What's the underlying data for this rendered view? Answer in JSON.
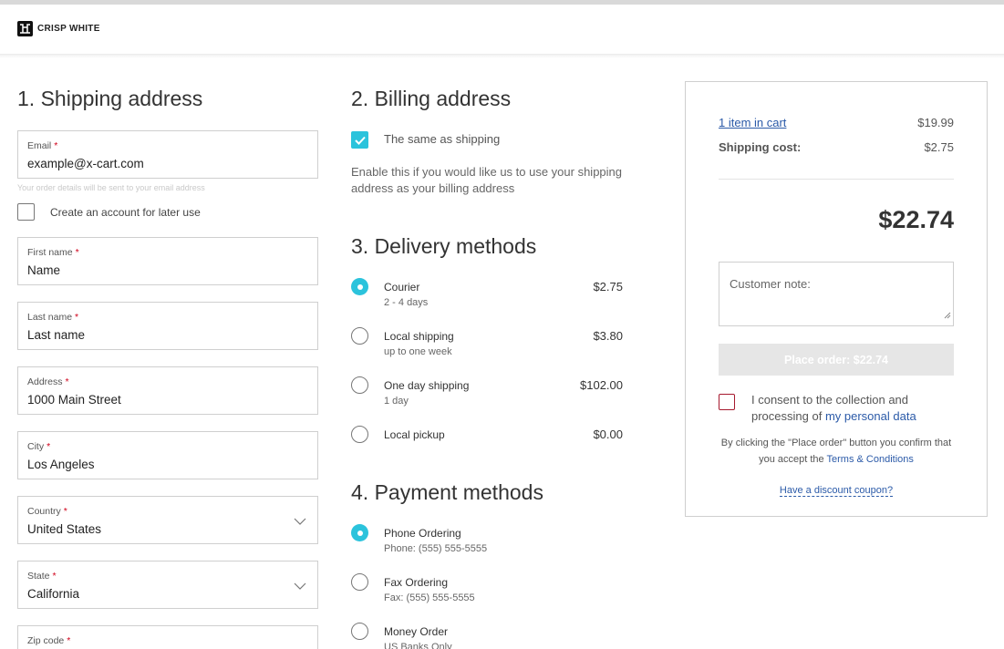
{
  "brand": {
    "name": "CRISP WHITE"
  },
  "shipping": {
    "title": "1. Shipping address",
    "email": {
      "label": "Email",
      "value": "example@x-cart.com",
      "hint": "Your order details will be sent to your email address"
    },
    "create_account_label": "Create an account for later use",
    "first_name": {
      "label": "First name",
      "value": "Name"
    },
    "last_name": {
      "label": "Last name",
      "value": "Last name"
    },
    "address": {
      "label": "Address",
      "value": "1000 Main Street"
    },
    "city": {
      "label": "City",
      "value": "Los Angeles"
    },
    "country": {
      "label": "Country",
      "value": "United States"
    },
    "state": {
      "label": "State",
      "value": "California"
    },
    "zip": {
      "label": "Zip code",
      "value": ""
    },
    "required_mark": "*"
  },
  "billing": {
    "title": "2. Billing address",
    "same_label": "The same as shipping",
    "description": "Enable this if you would like us to use your shipping address as your billing address"
  },
  "delivery": {
    "title": "3. Delivery methods",
    "options": [
      {
        "name": "Courier",
        "sub": "2 - 4 days",
        "price": "$2.75",
        "selected": true
      },
      {
        "name": "Local shipping",
        "sub": "up to one week",
        "price": "$3.80",
        "selected": false
      },
      {
        "name": "One day shipping",
        "sub": "1 day",
        "price": "$102.00",
        "selected": false
      },
      {
        "name": "Local pickup",
        "sub": "",
        "price": "$0.00",
        "selected": false
      }
    ]
  },
  "payment": {
    "title": "4. Payment methods",
    "options": [
      {
        "name": "Phone Ordering",
        "sub": "Phone: (555) 555-5555",
        "selected": true
      },
      {
        "name": "Fax Ordering",
        "sub": "Fax: (555) 555-5555",
        "selected": false
      },
      {
        "name": "Money Order",
        "sub": "US Banks Only",
        "selected": false
      }
    ]
  },
  "summary": {
    "items_link": "1 item in cart",
    "items_price": "$19.99",
    "shipping_label": "Shipping cost:",
    "shipping_price": "$2.75",
    "total": "$22.74",
    "note_placeholder": "Customer note:",
    "place_order_label": "Place order: $22.74",
    "consent_text": "I consent to the collection and processing of",
    "consent_link": "my personal data",
    "terms_text": "By clicking the \"Place order\" button you confirm that you accept the",
    "terms_link": "Terms & Conditions",
    "coupon_link": "Have a discount coupon?"
  },
  "colors": {
    "accent": "#2bc3dc",
    "link": "#2b5aa8",
    "required": "#d0021b",
    "consent_border": "#a6192e"
  }
}
